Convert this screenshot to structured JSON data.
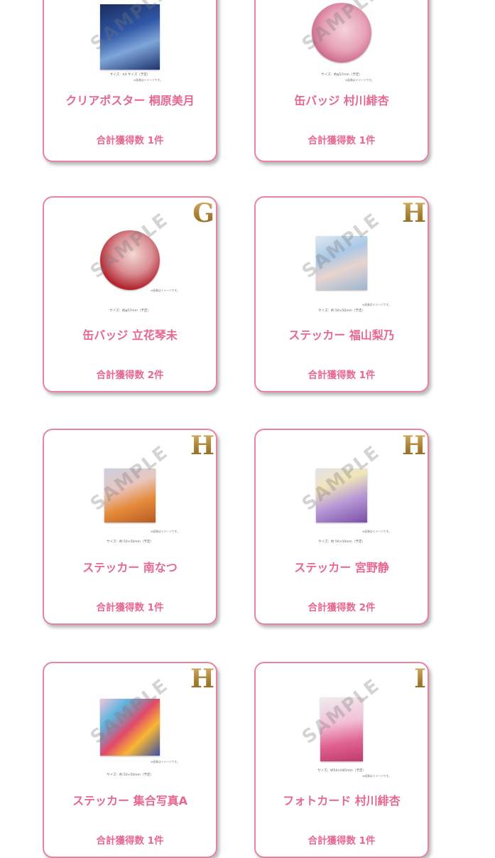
{
  "items": [
    {
      "grade": "",
      "title": "クリアポスター 桐原美月",
      "count": "合計獲得数 1件",
      "size_note": "サイズ：A4 サイズ（予定）",
      "image_note": "※画像はイメージです。",
      "stamp": "SAMPLE"
    },
    {
      "grade": "",
      "title": "缶バッジ 村川緋杏",
      "count": "合計獲得数 1件",
      "size_note": "サイズ：約φ57mm（予定）",
      "image_note": "※画像はイメージです。",
      "stamp": "SAMPLE"
    },
    {
      "grade": "G",
      "title": "缶バッジ 立花琴未",
      "count": "合計獲得数 2件",
      "size_note": "サイズ：約φ57mm（予定）",
      "image_note": "※画像はイメージです。",
      "stamp": "SAMPLE"
    },
    {
      "grade": "H",
      "title": "ステッカー 福山梨乃",
      "count": "合計獲得数 1件",
      "size_note": "サイズ：約 50×50mm（予定）",
      "image_note": "※画像はイメージです。",
      "stamp": "SAMPLE"
    },
    {
      "grade": "H",
      "title": "ステッカー 南なつ",
      "count": "合計獲得数 1件",
      "size_note": "サイズ：約 50×50mm（予定）",
      "image_note": "※画像はイメージです。",
      "stamp": "SAMPLE"
    },
    {
      "grade": "H",
      "title": "ステッカー 宮野静",
      "count": "合計獲得数 2件",
      "size_note": "サイズ：約 50×50mm（予定）",
      "image_note": "※画像はイメージです。",
      "stamp": "SAMPLE"
    },
    {
      "grade": "H",
      "title": "ステッカー 集合写真A",
      "count": "合計獲得数 1件",
      "size_note": "サイズ：約 50×50mm（予定）",
      "image_note": "※画像はイメージです。",
      "stamp": "SAMPLE"
    },
    {
      "grade": "I",
      "title": "フォトカード 村川緋杏",
      "count": "合計獲得数 1件",
      "size_note": "サイズ：W54×H85mm（予定）",
      "image_note": "※画像はイメージです。",
      "stamp": "SAMPLE"
    }
  ],
  "colors": {
    "accent": "#e7688f",
    "border": "#e8849e",
    "grade_gold": "#b08a46"
  }
}
